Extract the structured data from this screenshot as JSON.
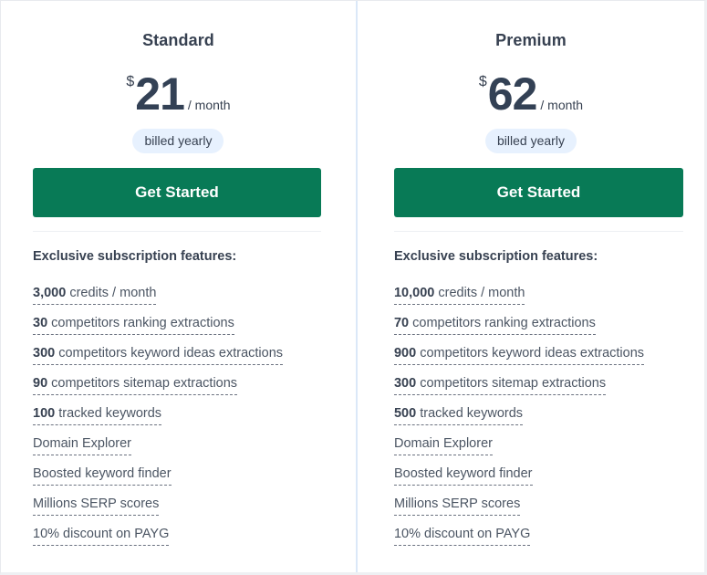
{
  "colors": {
    "button": "#087a56",
    "badge_bg": "#e7f1fe",
    "divider": "#dbe8f8"
  },
  "plans": [
    {
      "name": "Standard",
      "currency": "$",
      "amount": "21",
      "period": "/ month",
      "billing": "billed yearly",
      "cta": "Get Started",
      "features_title": "Exclusive subscription features:",
      "features": [
        {
          "bold": "3,000",
          "text": " credits / month"
        },
        {
          "bold": "30",
          "text": " competitors ranking extractions"
        },
        {
          "bold": "300",
          "text": " competitors keyword ideas extractions"
        },
        {
          "bold": "90",
          "text": " competitors sitemap extractions"
        },
        {
          "bold": "100",
          "text": " tracked keywords"
        },
        {
          "bold": "",
          "text": "Domain Explorer"
        },
        {
          "bold": "",
          "text": "Boosted keyword finder"
        },
        {
          "bold": "",
          "text": "Millions SERP scores"
        },
        {
          "bold": "",
          "text": "10% discount on PAYG"
        }
      ]
    },
    {
      "name": "Premium",
      "currency": "$",
      "amount": "62",
      "period": "/ month",
      "billing": "billed yearly",
      "cta": "Get Started",
      "features_title": "Exclusive subscription features:",
      "features": [
        {
          "bold": "10,000",
          "text": " credits / month"
        },
        {
          "bold": "70",
          "text": " competitors ranking extractions"
        },
        {
          "bold": "900",
          "text": " competitors keyword ideas extractions"
        },
        {
          "bold": "300",
          "text": " competitors sitemap extractions"
        },
        {
          "bold": "500",
          "text": " tracked keywords"
        },
        {
          "bold": "",
          "text": "Domain Explorer"
        },
        {
          "bold": "",
          "text": "Boosted keyword finder"
        },
        {
          "bold": "",
          "text": "Millions SERP scores"
        },
        {
          "bold": "",
          "text": "10% discount on PAYG"
        }
      ]
    }
  ]
}
